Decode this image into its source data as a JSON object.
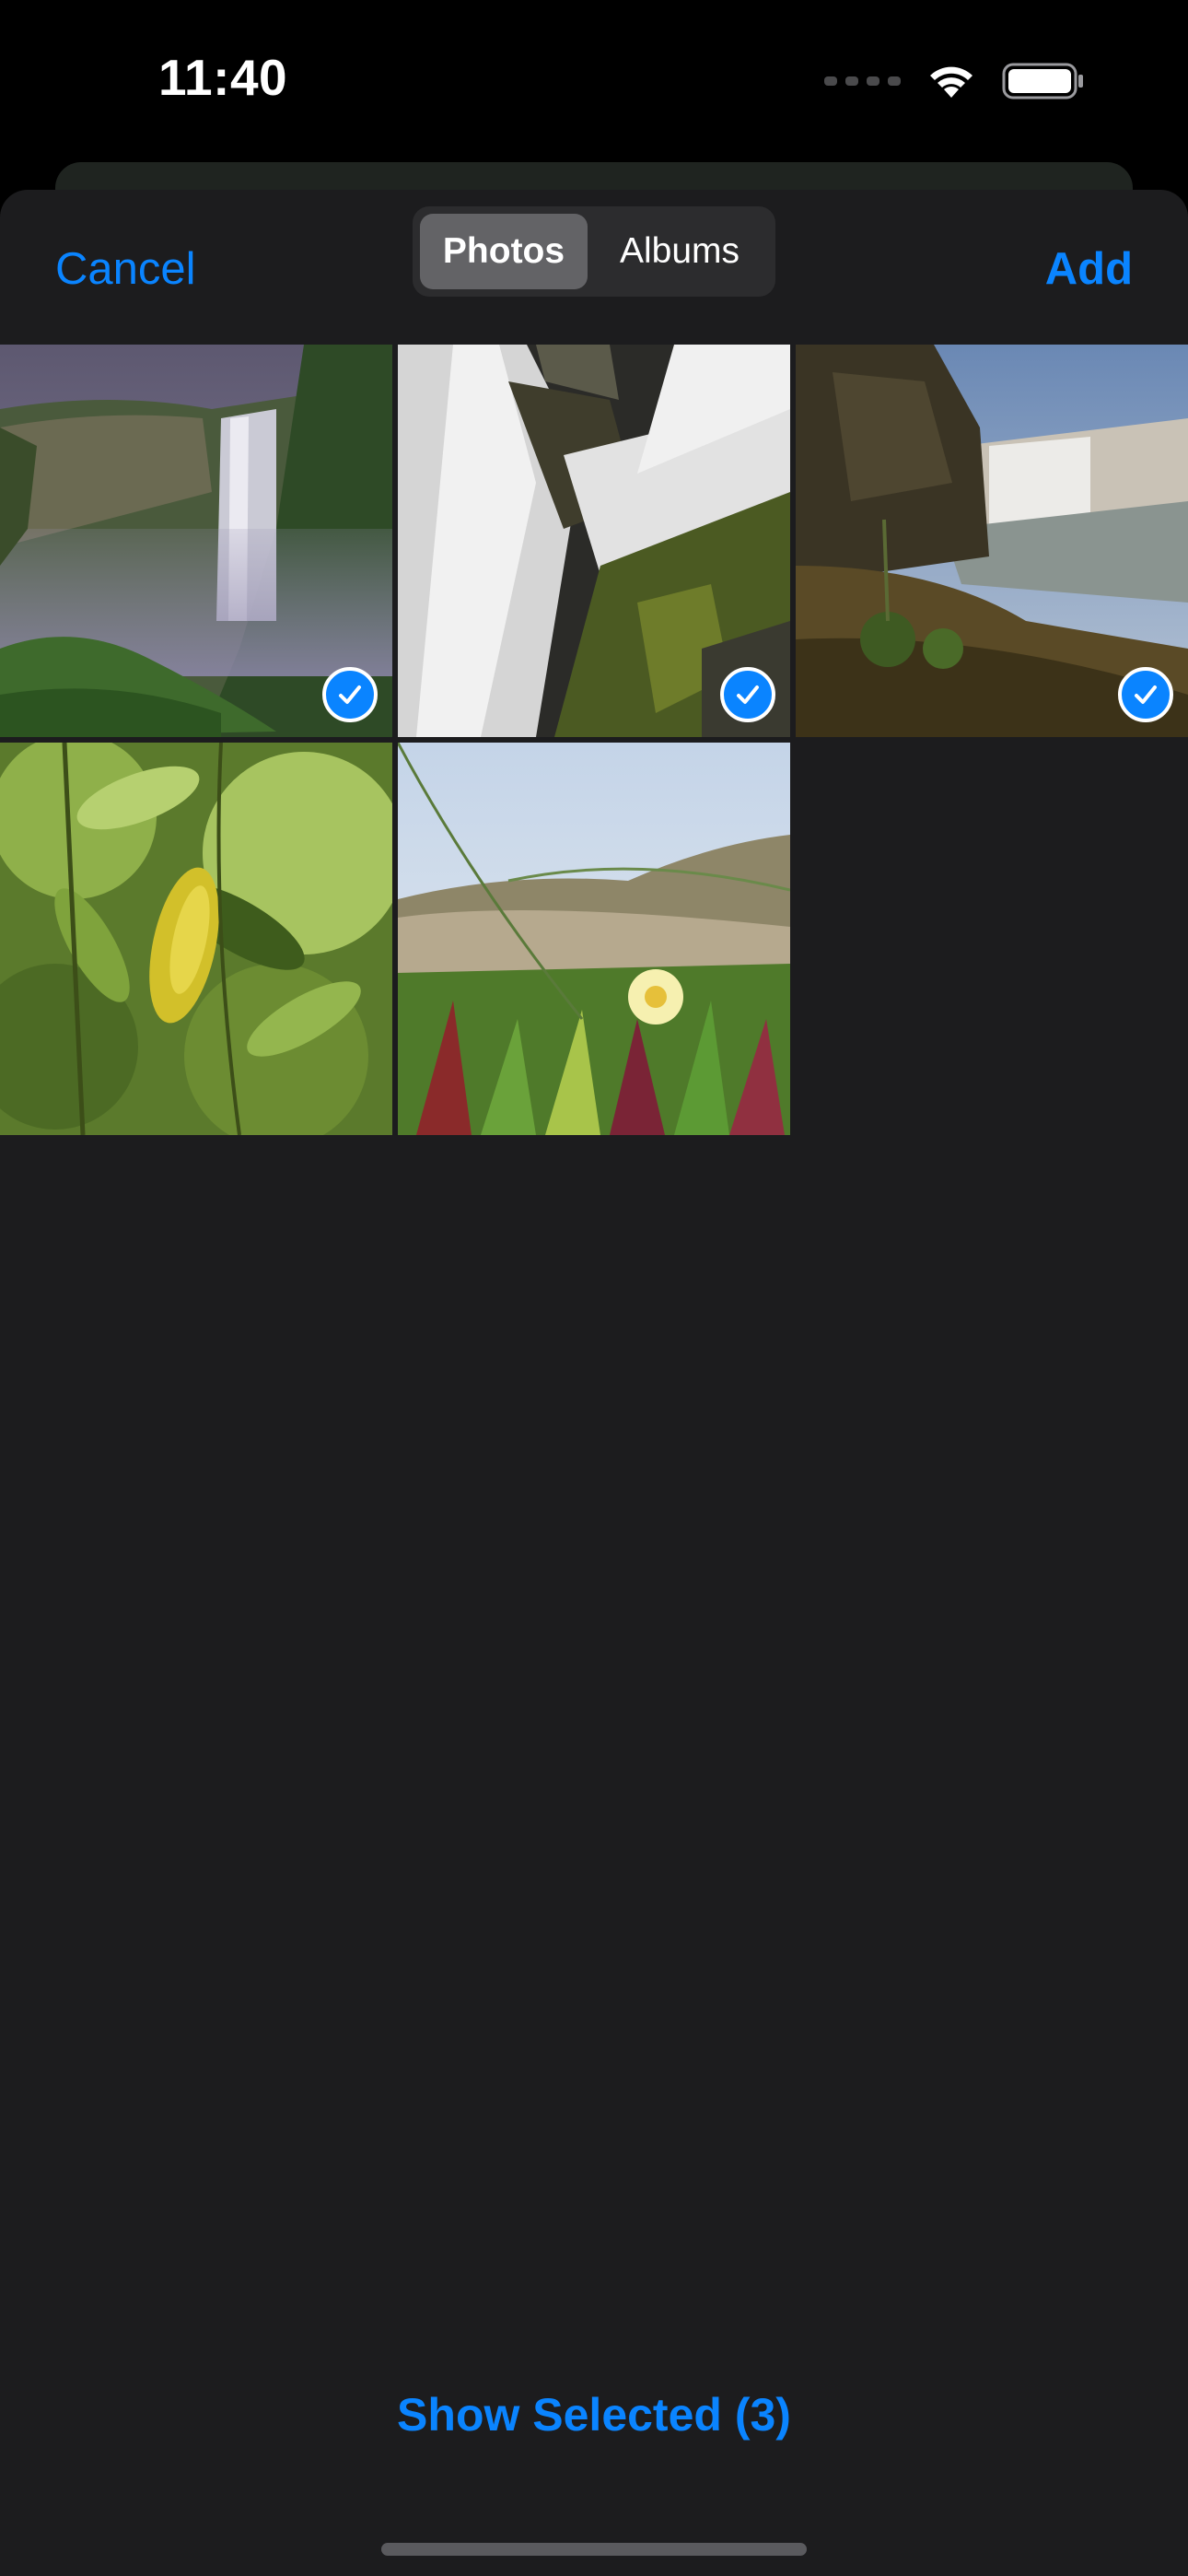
{
  "status_bar": {
    "time": "11:40",
    "icons": [
      "cellular-signal-icon",
      "wifi-icon",
      "battery-icon"
    ]
  },
  "nav": {
    "cancel_label": "Cancel",
    "add_label": "Add",
    "tabs": [
      {
        "label": "Photos",
        "selected": true
      },
      {
        "label": "Albums",
        "selected": false
      }
    ]
  },
  "photos": [
    {
      "subject": "waterfall-cliff",
      "selected": true
    },
    {
      "subject": "waterfall-closeup",
      "selected": true
    },
    {
      "subject": "waterfall-shore",
      "selected": true
    },
    {
      "subject": "lemon-leaves",
      "selected": false
    },
    {
      "subject": "dune-flower",
      "selected": false
    }
  ],
  "footer": {
    "show_selected_label": "Show Selected (3)"
  },
  "colors": {
    "accent": "#0a84ff",
    "sheet_background": "#1c1c1e",
    "segment_selected": "#636366"
  }
}
